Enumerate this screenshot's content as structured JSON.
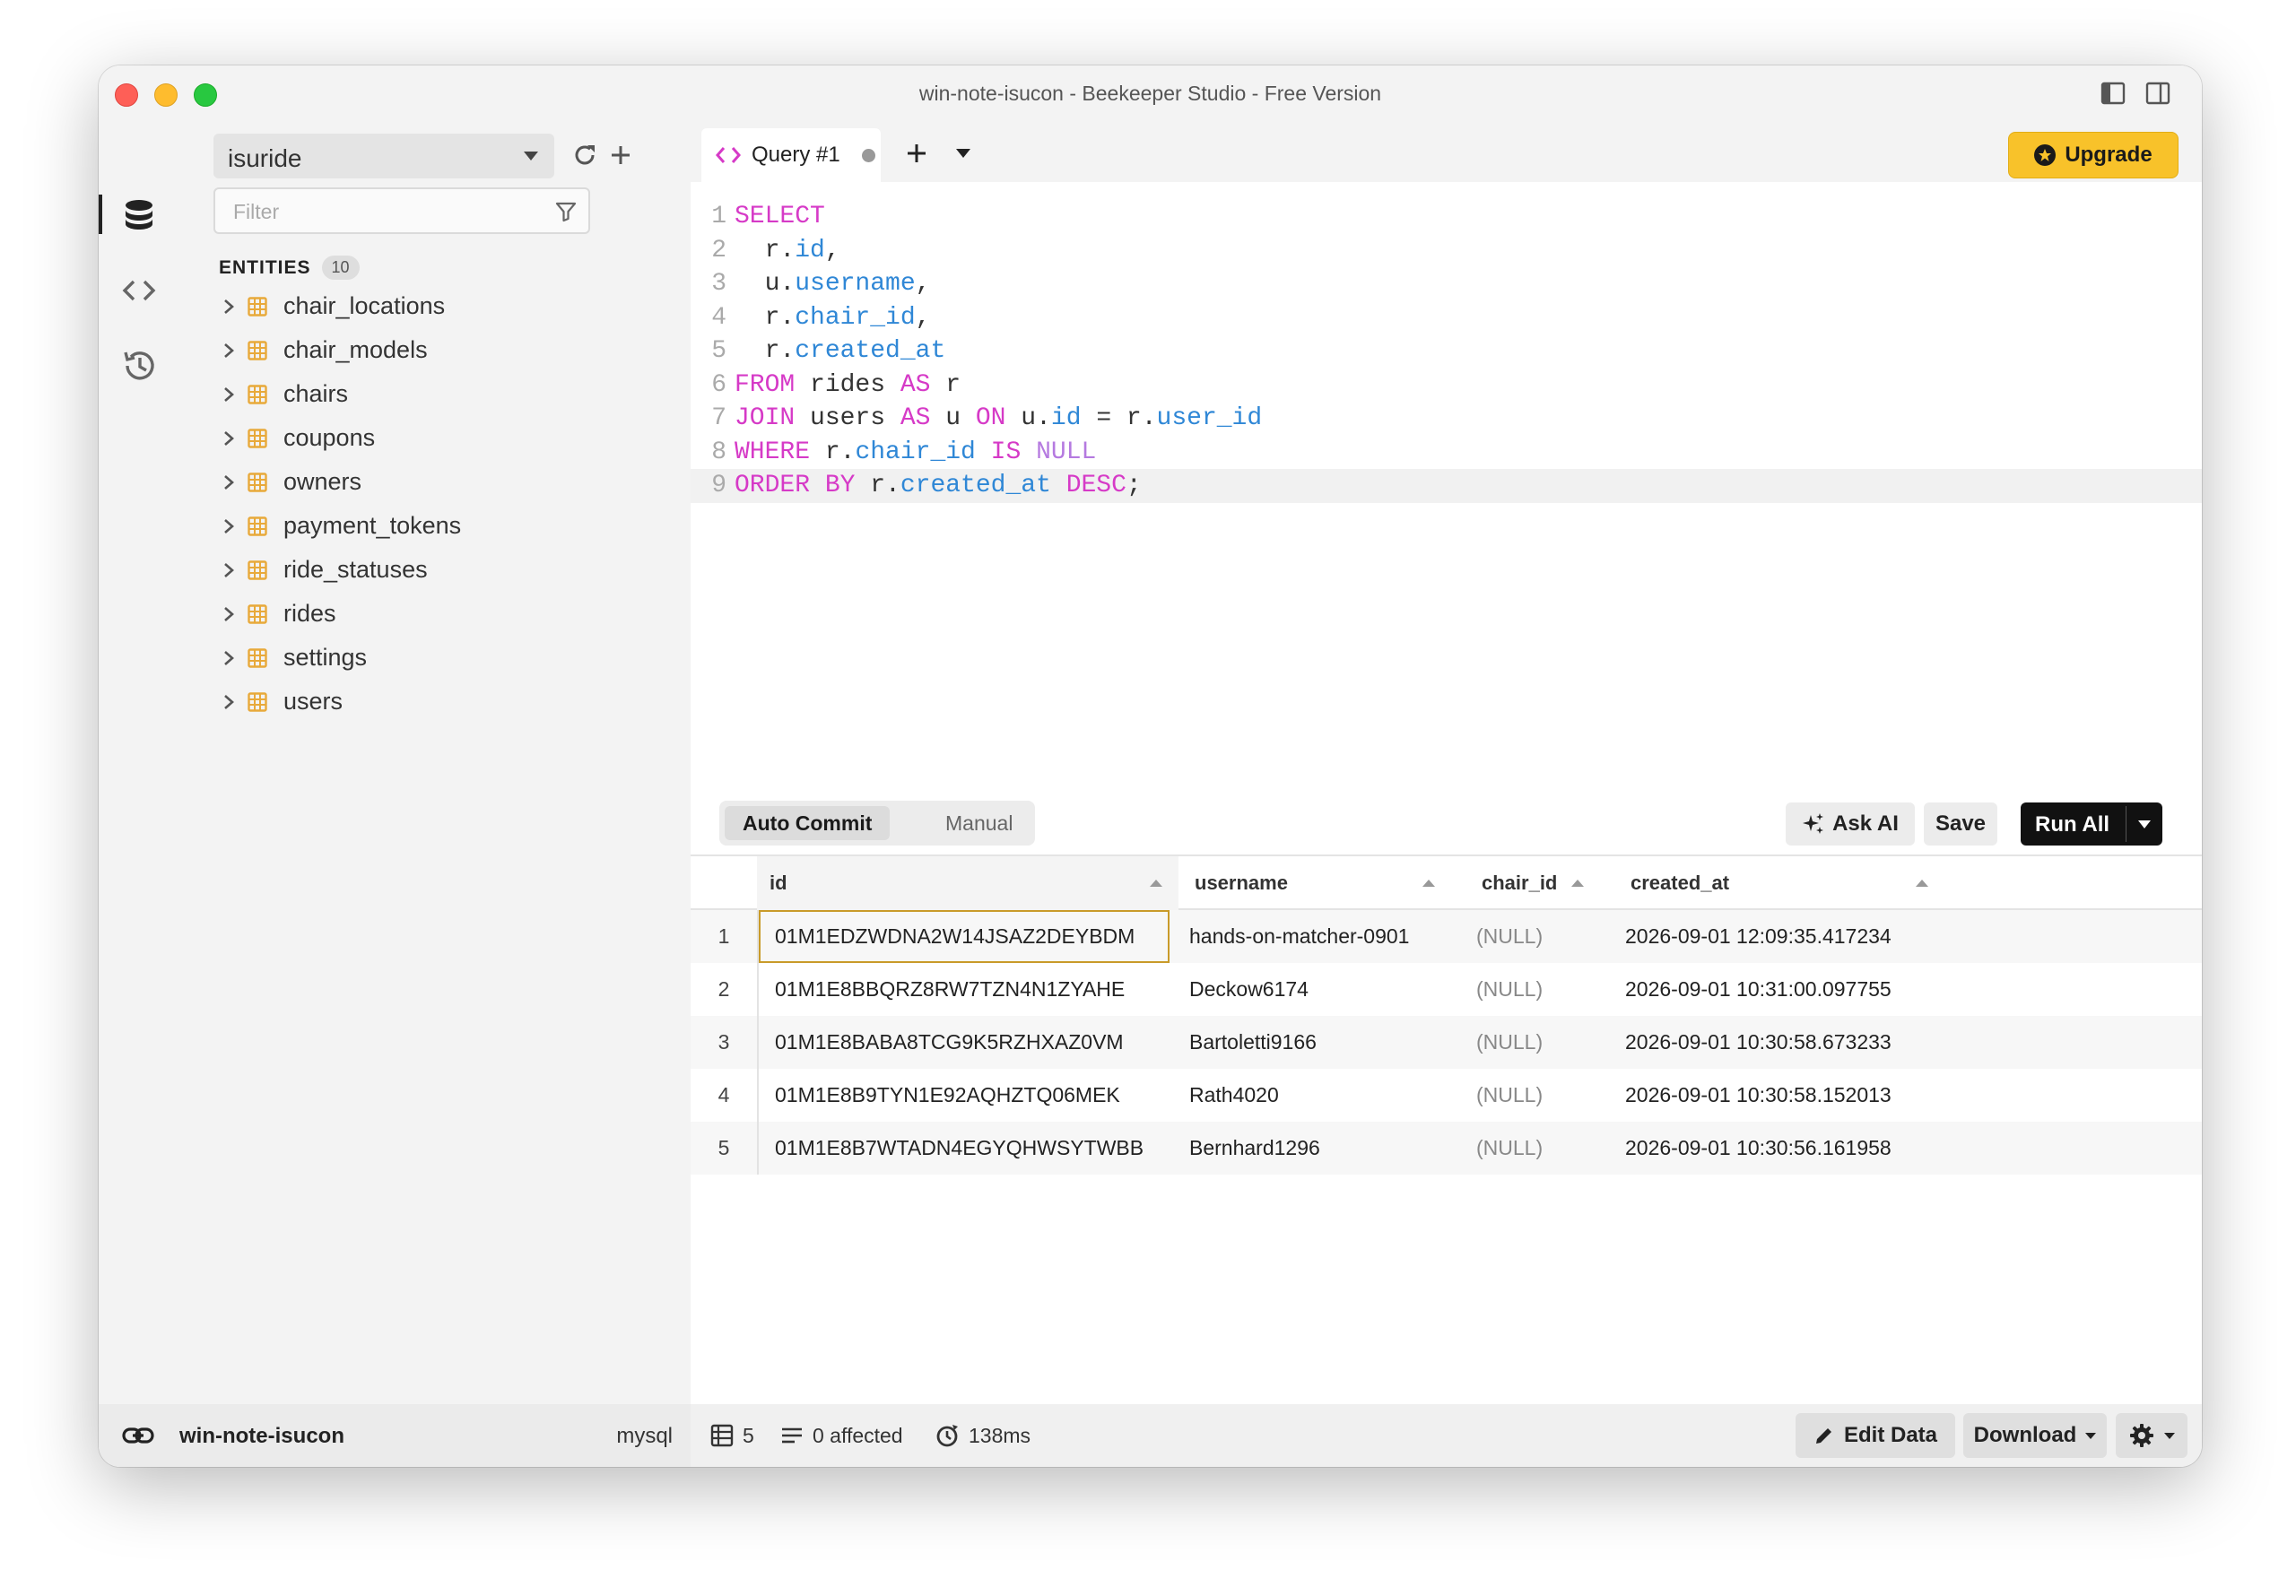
{
  "window": {
    "title": "win-note-isucon - Beekeeper Studio - Free Version"
  },
  "colors": {
    "accent_upgrade": "#f8c22a",
    "keyword": "#d63ac7",
    "field": "#2f87d6",
    "null_keyword": "#b57ae0",
    "table_icon": "#e8a93a",
    "selection_border": "#c99b2a"
  },
  "sidebar": {
    "connection": "isuride",
    "filter_placeholder": "Filter",
    "entities_label": "ENTITIES",
    "entities_count": "10",
    "entities": [
      "chair_locations",
      "chair_models",
      "chairs",
      "coupons",
      "owners",
      "payment_tokens",
      "ride_statuses",
      "rides",
      "settings",
      "users"
    ]
  },
  "tabs": {
    "query_tab": "Query #1",
    "upgrade_label": "Upgrade"
  },
  "editor": {
    "line_numbers": [
      "1",
      "2",
      "3",
      "4",
      "5",
      "6",
      "7",
      "8",
      "9"
    ],
    "lines": [
      [
        {
          "t": "SELECT",
          "c": "kw"
        }
      ],
      [
        {
          "t": "  r.",
          "c": ""
        },
        {
          "t": "id",
          "c": "fld"
        },
        {
          "t": ",",
          "c": ""
        }
      ],
      [
        {
          "t": "  u.",
          "c": ""
        },
        {
          "t": "username",
          "c": "fld"
        },
        {
          "t": ",",
          "c": ""
        }
      ],
      [
        {
          "t": "  r.",
          "c": ""
        },
        {
          "t": "chair_id",
          "c": "fld"
        },
        {
          "t": ",",
          "c": ""
        }
      ],
      [
        {
          "t": "  r.",
          "c": ""
        },
        {
          "t": "created_at",
          "c": "fld"
        }
      ],
      [
        {
          "t": "FROM",
          "c": "kw"
        },
        {
          "t": " rides ",
          "c": ""
        },
        {
          "t": "AS",
          "c": "kw"
        },
        {
          "t": " r",
          "c": ""
        }
      ],
      [
        {
          "t": "JOIN",
          "c": "kw"
        },
        {
          "t": " users ",
          "c": ""
        },
        {
          "t": "AS",
          "c": "kw"
        },
        {
          "t": " u ",
          "c": ""
        },
        {
          "t": "ON",
          "c": "kw"
        },
        {
          "t": " u.",
          "c": ""
        },
        {
          "t": "id",
          "c": "fld"
        },
        {
          "t": " = r.",
          "c": ""
        },
        {
          "t": "user_id",
          "c": "fld"
        }
      ],
      [
        {
          "t": "WHERE",
          "c": "kw"
        },
        {
          "t": " r.",
          "c": ""
        },
        {
          "t": "chair_id",
          "c": "fld"
        },
        {
          "t": " ",
          "c": ""
        },
        {
          "t": "IS",
          "c": "kw"
        },
        {
          "t": " ",
          "c": ""
        },
        {
          "t": "NULL",
          "c": "nul"
        }
      ],
      [
        {
          "t": "ORDER BY",
          "c": "kw"
        },
        {
          "t": " r.",
          "c": ""
        },
        {
          "t": "created_at",
          "c": "fld"
        },
        {
          "t": " ",
          "c": ""
        },
        {
          "t": "DESC",
          "c": "kw"
        },
        {
          "t": ";",
          "c": ""
        }
      ]
    ]
  },
  "results": {
    "auto_commit": "Auto Commit",
    "manual": "Manual",
    "ask_ai": "Ask AI",
    "save": "Save",
    "run_all": "Run All",
    "columns": [
      "id",
      "username",
      "chair_id",
      "created_at"
    ],
    "rows": [
      {
        "n": "1",
        "id": "01M1EDZWDNA2W14JSAZ2DEYBDM",
        "username": "hands-on-matcher-0901",
        "chair_id": "(NULL)",
        "created_at": "2026-09-01 12:09:35.417234"
      },
      {
        "n": "2",
        "id": "01M1E8BBQRZ8RW7TZN4N1ZYAHE",
        "username": "Deckow6174",
        "chair_id": "(NULL)",
        "created_at": "2026-09-01 10:31:00.097755"
      },
      {
        "n": "3",
        "id": "01M1E8BABA8TCG9K5RZHXAZ0VM",
        "username": "Bartoletti9166",
        "chair_id": "(NULL)",
        "created_at": "2026-09-01 10:30:58.673233"
      },
      {
        "n": "4",
        "id": "01M1E8B9TYN1E92AQHZTQ06MEK",
        "username": "Rath4020",
        "chair_id": "(NULL)",
        "created_at": "2026-09-01 10:30:58.152013"
      },
      {
        "n": "5",
        "id": "01M1E8B7WTADN4EGYQHWSYTWBB",
        "username": "Bernhard1296",
        "chair_id": "(NULL)",
        "created_at": "2026-09-01 10:30:56.161958"
      }
    ]
  },
  "status": {
    "connection_name": "win-note-isucon",
    "db_type": "mysql",
    "row_count": "5",
    "affected": "0 affected",
    "duration": "138ms",
    "edit_data": "Edit Data",
    "download": "Download"
  }
}
